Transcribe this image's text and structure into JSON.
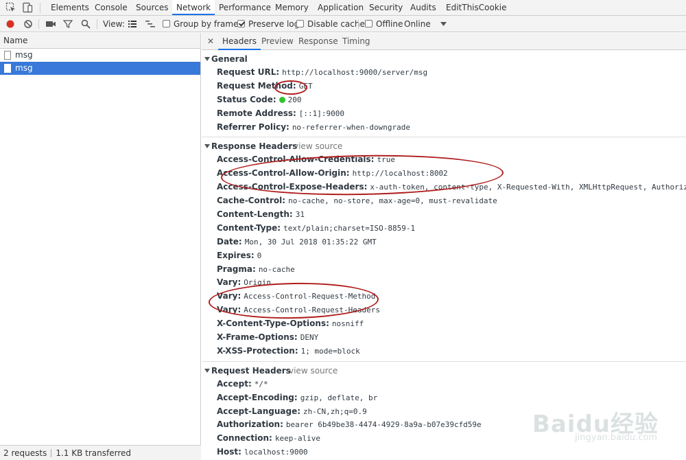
{
  "topbar": {
    "tabs": [
      {
        "label": "Elements"
      },
      {
        "label": "Console"
      },
      {
        "label": "Sources"
      },
      {
        "label": "Network"
      },
      {
        "label": "Performance"
      },
      {
        "label": "Memory"
      },
      {
        "label": "Application"
      },
      {
        "label": "Security"
      },
      {
        "label": "Audits"
      },
      {
        "label": "EditThisCookie"
      }
    ],
    "active_tab": "Network",
    "icons": [
      "inspect-element-icon",
      "device-toolbar-icon"
    ]
  },
  "toolbar": {
    "view_label": "View:",
    "group_by_frame": {
      "label": "Group by frame",
      "checked": false
    },
    "preserve_log": {
      "label": "Preserve log",
      "checked": true
    },
    "disable_cache": {
      "label": "Disable cache",
      "checked": false
    },
    "offline": {
      "label": "Offline",
      "checked": false
    },
    "throttle": {
      "value": "Online"
    },
    "record_color": "#d93025"
  },
  "request_list": {
    "header": "Name",
    "items": [
      {
        "name": "msg",
        "selected": false
      },
      {
        "name": "msg",
        "selected": true
      }
    ],
    "footer": {
      "requests": "2 requests",
      "transferred": "1.1 KB transferred"
    }
  },
  "detail": {
    "tabs": [
      {
        "label": "Headers"
      },
      {
        "label": "Preview"
      },
      {
        "label": "Response"
      },
      {
        "label": "Timing"
      }
    ],
    "active_tab": "Headers",
    "general": {
      "title": "General",
      "rows": [
        {
          "key": "Request URL:",
          "value": "http://localhost:9000/server/msg"
        },
        {
          "key": "Request Method:",
          "value": "GET"
        },
        {
          "key": "Status Code:",
          "value": "200"
        },
        {
          "key": "Remote Address:",
          "value": "[::1]:9000"
        },
        {
          "key": "Referrer Policy:",
          "value": "no-referrer-when-downgrade"
        }
      ]
    },
    "response_headers": {
      "title": "Response Headers",
      "view_source": "view source",
      "rows": [
        {
          "key": "Access-Control-Allow-Credentials:",
          "value": "true"
        },
        {
          "key": "Access-Control-Allow-Origin:",
          "value": "http://localhost:8002"
        },
        {
          "key": "Access-Control-Expose-Headers:",
          "value": "x-auth-token, content-type, X-Requested-With, XMLHttpRequest, Authorization"
        },
        {
          "key": "Cache-Control:",
          "value": "no-cache, no-store, max-age=0, must-revalidate"
        },
        {
          "key": "Content-Length:",
          "value": "31"
        },
        {
          "key": "Content-Type:",
          "value": "text/plain;charset=ISO-8859-1"
        },
        {
          "key": "Date:",
          "value": "Mon, 30 Jul 2018 01:35:22 GMT"
        },
        {
          "key": "Expires:",
          "value": "0"
        },
        {
          "key": "Pragma:",
          "value": "no-cache"
        },
        {
          "key": "Vary:",
          "value": "Origin"
        },
        {
          "key": "Vary:",
          "value": "Access-Control-Request-Method"
        },
        {
          "key": "Vary:",
          "value": "Access-Control-Request-Headers"
        },
        {
          "key": "X-Content-Type-Options:",
          "value": "nosniff"
        },
        {
          "key": "X-Frame-Options:",
          "value": "DENY"
        },
        {
          "key": "X-XSS-Protection:",
          "value": "1; mode=block"
        }
      ]
    },
    "request_headers": {
      "title": "Request Headers",
      "view_source": "view source",
      "rows": [
        {
          "key": "Accept:",
          "value": "*/*"
        },
        {
          "key": "Accept-Encoding:",
          "value": "gzip, deflate, br"
        },
        {
          "key": "Accept-Language:",
          "value": "zh-CN,zh;q=0.9"
        },
        {
          "key": "Authorization:",
          "value": "bearer 6b49be38-4474-4929-8a9a-b07e39cfd59e"
        },
        {
          "key": "Connection:",
          "value": "keep-alive"
        },
        {
          "key": "Host:",
          "value": "localhost:9000"
        }
      ]
    },
    "status_dot_color": "#2ec42e",
    "annotation_color": "#b01d1d"
  },
  "watermark": {
    "text": "Baidu经验",
    "sub": "jingyan.baidu.com"
  }
}
